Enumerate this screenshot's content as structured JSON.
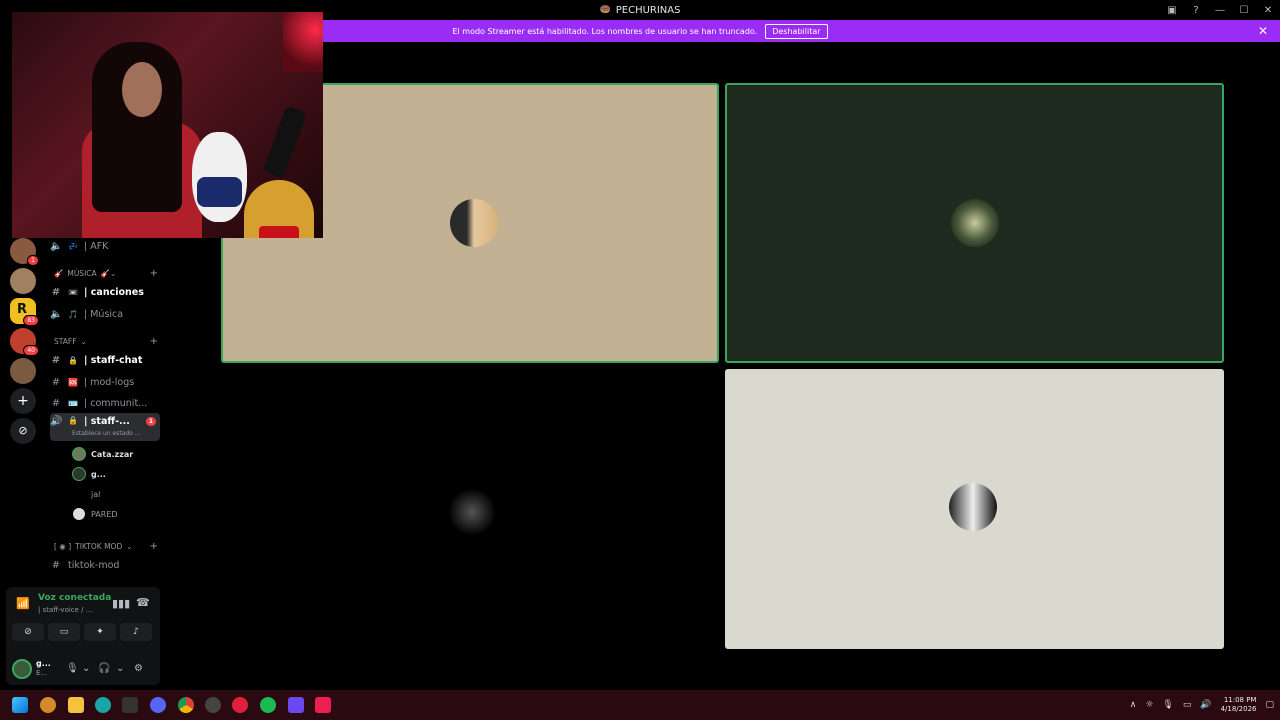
{
  "window": {
    "title": "PECHURINAS"
  },
  "streamer_banner": {
    "message": "El modo Streamer está habilitado. Los nombres de usuario se han truncado.",
    "button": "Deshabilitar",
    "close": "✕"
  },
  "servers": [
    {
      "badge": "1"
    },
    {
      "badge": ""
    },
    {
      "badge": "83"
    },
    {
      "badge": "40"
    },
    {
      "badge": ""
    }
  ],
  "channels": {
    "afk": "| AFK",
    "musica_category": "MÚSICA",
    "canciones": "| canciones",
    "musica": "| Música",
    "staff_category": "STAFF",
    "staff_chat": "| staff-chat",
    "mod_logs": "| mod-logs",
    "communit": "| communit...",
    "staff_voice": "| staff-...",
    "staff_voice_badge": "1",
    "staff_voice_status": "Establece un estado ...",
    "voice_users": [
      "Cata.zzar",
      "g...",
      "jal",
      "PARED"
    ],
    "tiktok_category": "TIKTOK MOD",
    "tiktok_mod": "tiktok-mod"
  },
  "voice_panel": {
    "status": "Voz conectada",
    "channel": "| staff-voice / ...",
    "user_name": "g...",
    "user_status": "E..."
  },
  "taskbar": {
    "time": "11:08 PM",
    "date": "4/18/2026"
  },
  "colors": {
    "banner": "#9b2cf5",
    "speaking": "#3ba55d",
    "tile1": "#c2b193",
    "tile2": "#1f2a1f",
    "tile4": "#dad9d0"
  }
}
